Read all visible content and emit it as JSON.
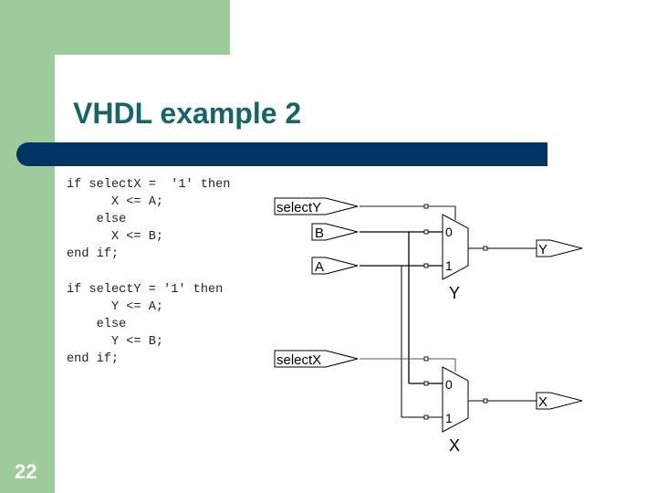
{
  "slide": {
    "title": "VHDL example 2",
    "page_number": "22",
    "colors": {
      "accent_green": "#9ecb9b",
      "title_teal": "#17656a",
      "bar_navy": "#003462"
    }
  },
  "code_blocks": [
    {
      "lines": [
        "if selectX =  '1' then",
        "      X <= A;",
        "    else",
        "      X <= B;",
        "end if;"
      ]
    },
    {
      "lines": [
        "if selectY = '1' then",
        "      Y <= A;",
        "    else",
        "      Y <= B;",
        "end if;"
      ]
    }
  ],
  "schematic": {
    "input_ports": [
      "selectY",
      "B",
      "A",
      "selectX"
    ],
    "output_ports": [
      "Y",
      "X"
    ],
    "muxes": [
      {
        "name": "Y",
        "input0": "0",
        "input1": "1"
      },
      {
        "name": "X",
        "input0": "0",
        "input1": "1"
      }
    ]
  }
}
